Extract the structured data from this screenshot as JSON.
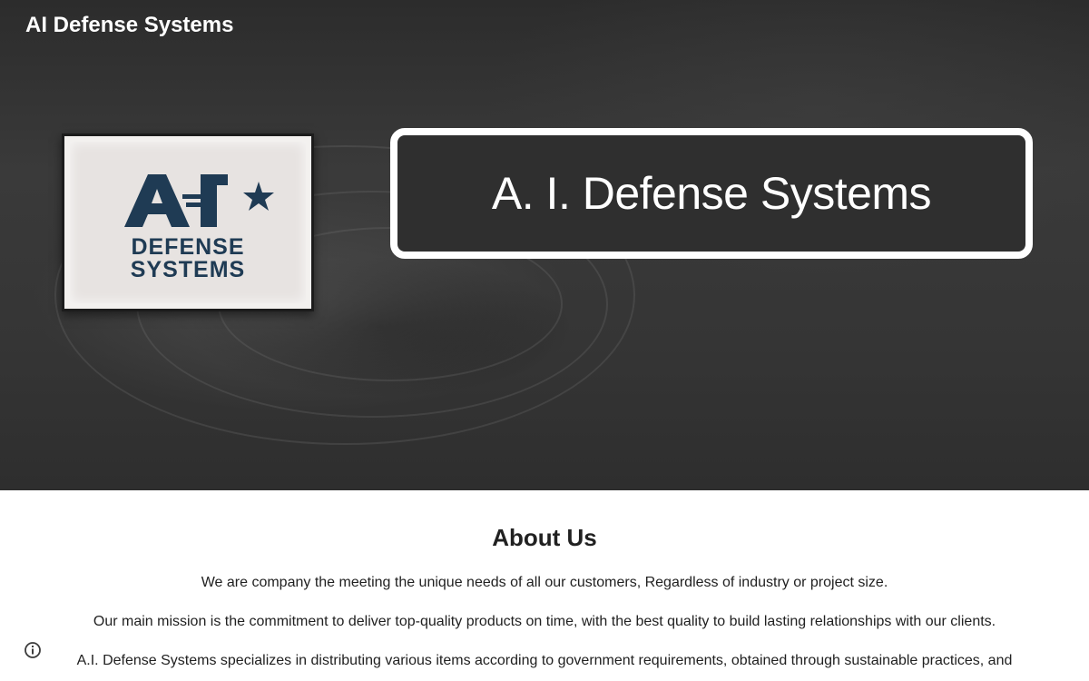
{
  "header": {
    "site_title": "AI Defense Systems"
  },
  "hero": {
    "headline": "A. I. Defense Systems",
    "logo": {
      "mark_text": "AI",
      "line1": "DEFENSE",
      "line2": "SYSTEMS",
      "brand_color": "#1f3b54"
    }
  },
  "about": {
    "title": "About Us",
    "paragraphs": [
      "We are company the meeting the unique needs of all our customers, Regardless of industry or project size.",
      "Our main mission is the commitment to deliver top-quality products on time, with the best quality to build lasting relationships with our clients.",
      "A.I. Defense Systems specializes in distributing various items according to government requirements, obtained through sustainable practices, and"
    ]
  },
  "footer": {
    "info_icon": "info-icon"
  }
}
